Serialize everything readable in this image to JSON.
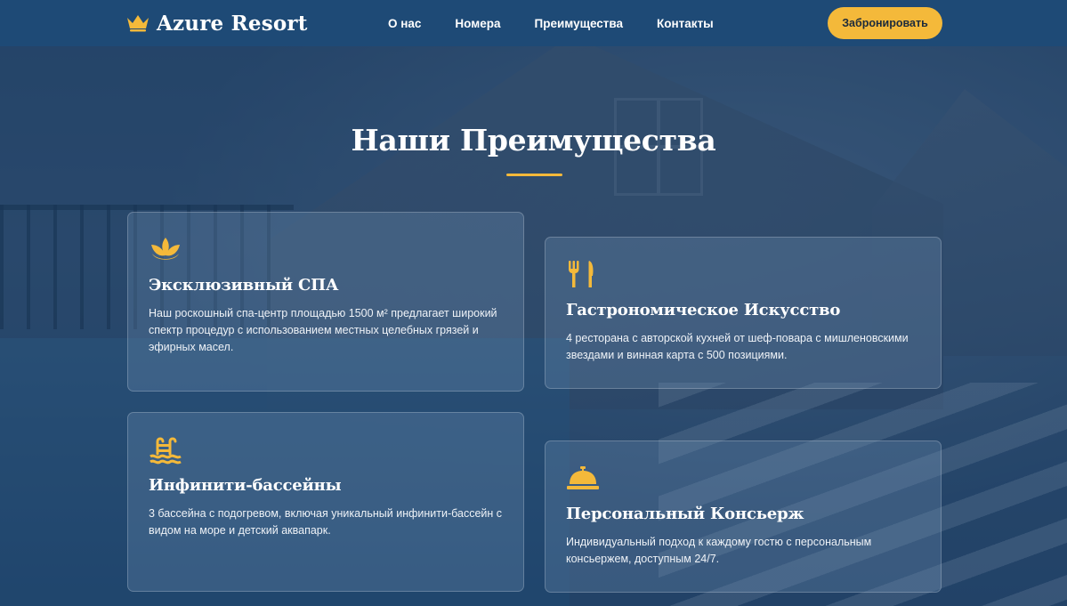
{
  "brand": {
    "name": "Azure Resort",
    "icon": "crown-icon"
  },
  "nav": {
    "items": [
      {
        "label": "О нас"
      },
      {
        "label": "Номера"
      },
      {
        "label": "Преимущества"
      },
      {
        "label": "Контакты"
      }
    ],
    "cta_label": "Забронировать"
  },
  "section": {
    "title": "Наши Преимущества"
  },
  "features": [
    {
      "icon": "lotus-icon",
      "title": "Эксклюзивный СПА",
      "text": "Наш роскошный спа-центр площадью 1500 м² предлагает широкий спектр процедур с использованием местных целебных грязей и эфирных масел."
    },
    {
      "icon": "utensils-icon",
      "title": "Гастрономическое Искусство",
      "text": "4 ресторана с авторской кухней от шеф-повара с мишленовскими звездами и винная карта с 500 позициями."
    },
    {
      "icon": "swimming-pool-icon",
      "title": "Инфинити-бассейны",
      "text": "3 бассейна с подогревом, включая уникальный инфинити-бассейн с видом на море и детский аквапарк."
    },
    {
      "icon": "concierge-bell-icon",
      "title": "Персональный Консьерж",
      "text": "Индивидуальный подход к каждому гостю с персональным консьержем, доступным 24/7."
    }
  ],
  "colors": {
    "accent": "#f4b93a",
    "header_bg": "#1e4a76",
    "overlay": "#183a62"
  }
}
